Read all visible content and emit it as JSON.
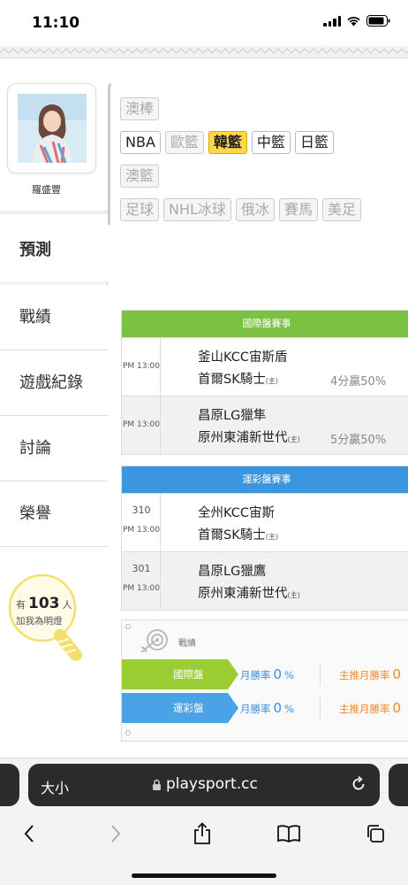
{
  "status_bar": {
    "time": "11:10"
  },
  "profile": {
    "name": "羅盛豐"
  },
  "side_menu": {
    "items": [
      {
        "label": "預測"
      },
      {
        "label": "戰績"
      },
      {
        "label": "遊戲紀錄"
      },
      {
        "label": "討論"
      },
      {
        "label": "榮譽"
      }
    ]
  },
  "light": {
    "prefix": "有",
    "count": "103",
    "suffix": "人",
    "subtitle": "加我為明燈"
  },
  "sports": {
    "row1": [
      {
        "label": "澳棒",
        "state": "disabled"
      }
    ],
    "row2": [
      {
        "label": "NBA",
        "state": "enabled"
      },
      {
        "label": "歐籃",
        "state": "disabled"
      },
      {
        "label": "韓籃",
        "state": "selected"
      },
      {
        "label": "中籃",
        "state": "enabled"
      },
      {
        "label": "日籃",
        "state": "enabled"
      }
    ],
    "row3": [
      {
        "label": "澳籃",
        "state": "disabled"
      }
    ],
    "row4": [
      {
        "label": "足球",
        "state": "disabled"
      },
      {
        "label": "NHL冰球",
        "state": "disabled"
      },
      {
        "label": "俄冰",
        "state": "disabled"
      },
      {
        "label": "賽馬",
        "state": "disabled"
      },
      {
        "label": "美足",
        "state": "disabled"
      }
    ]
  },
  "intl": {
    "header": "國際盤賽事",
    "color": "#7cc242",
    "games": [
      {
        "time": "PM 13:00",
        "team1": "釜山KCC宙斯盾",
        "team2": "首爾SK騎士",
        "home": "(主)",
        "handicap": "4分贏50%"
      },
      {
        "time": "PM 13:00",
        "team1": "昌原LG獵隼",
        "team2": "原州東浦新世代",
        "home": "(主)",
        "handicap": "5分贏50%"
      }
    ]
  },
  "lottery": {
    "header": "運彩盤賽事",
    "color": "#3b96e0",
    "games": [
      {
        "no": "310",
        "time": "PM 13:00",
        "team1": "全州KCC宙斯",
        "team2": "首爾SK騎士",
        "home": "(主)"
      },
      {
        "no": "301",
        "time": "PM 13:00",
        "team1": "昌原LG獵鷹",
        "team2": "原州東浦新世代",
        "home": "(主)"
      }
    ]
  },
  "record": {
    "title": "戰績",
    "rows": [
      {
        "label": "國際盤",
        "color": "#9acd32",
        "rate_label": "月勝率",
        "rate": "0",
        "unit": "%",
        "main_label": "主推月勝率",
        "main_rate": "0"
      },
      {
        "label": "運彩盤",
        "color": "#4aa3e6",
        "rate_label": "月勝率",
        "rate": "0",
        "unit": "%",
        "main_label": "主推月勝率",
        "main_rate": "0"
      }
    ]
  },
  "safari": {
    "aa": "大小",
    "url": "playsport.cc"
  }
}
